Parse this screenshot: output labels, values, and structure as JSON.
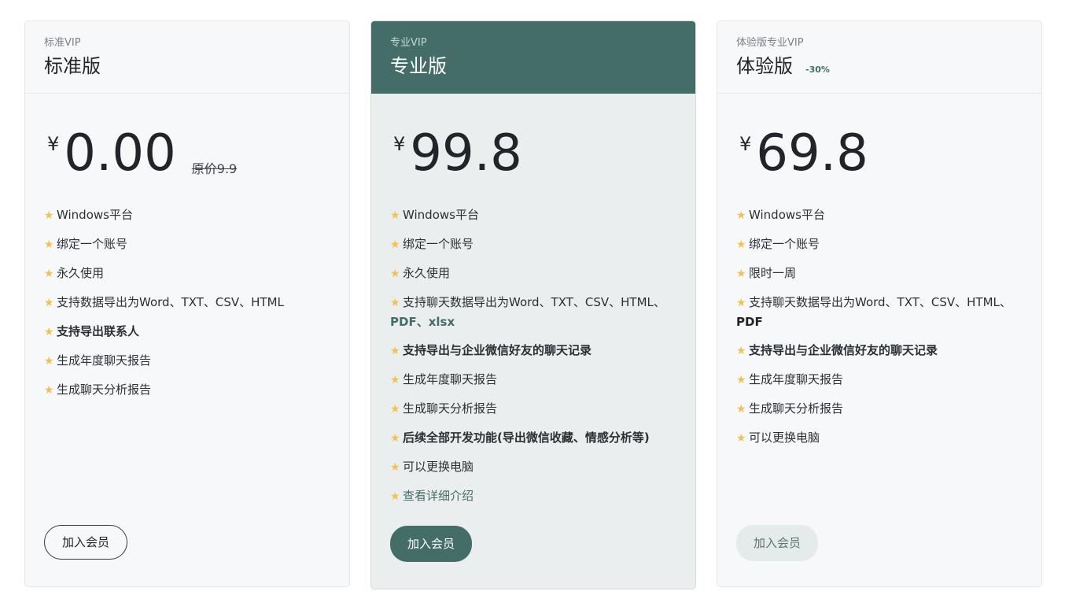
{
  "plans": [
    {
      "tier": "标准VIP",
      "title": "标准版",
      "discount": "",
      "currency": "¥",
      "price": "0.00",
      "original_price": "原价9.9",
      "features": {
        "f1": "Windows平台",
        "f2": "绑定一个账号",
        "f3": "永久使用",
        "f4": "支持数据导出为Word、TXT、CSV、HTML",
        "f5": "支持导出联系人",
        "f6": "生成年度聊天报告",
        "f7": "生成聊天分析报告"
      },
      "button": "加入会员"
    },
    {
      "tier": "专业VIP",
      "title": "专业版",
      "discount": "",
      "currency": "¥",
      "price": "99.8",
      "original_price": "",
      "features": {
        "f1": "Windows平台",
        "f2": "绑定一个账号",
        "f3": "永久使用",
        "f4a": "支持聊天数据导出为Word、TXT、CSV、HTML、",
        "f4b": "PDF",
        "f4c": "、",
        "f4d": "xlsx",
        "f5": "支持导出与企业微信好友的聊天记录",
        "f6": "生成年度聊天报告",
        "f7": "生成聊天分析报告",
        "f8": "后续全部开发功能(导出微信收藏、情感分析等)",
        "f9": "可以更换电脑",
        "f10": "查看详细介绍"
      },
      "button": "加入会员"
    },
    {
      "tier": "体验版专业VIP",
      "title": "体验版",
      "discount": "-30%",
      "currency": "¥",
      "price": "69.8",
      "original_price": "",
      "features": {
        "f1": "Windows平台",
        "f2": "绑定一个账号",
        "f3": "限时一周",
        "f4a": "支持聊天数据导出为Word、TXT、CSV、HTML、",
        "f4b": "PDF",
        "f5": "支持导出与企业微信好友的聊天记录",
        "f6": "生成年度聊天报告",
        "f7": "生成聊天分析报告",
        "f8": "可以更换电脑"
      },
      "button": "加入会员"
    }
  ],
  "icons": {
    "bullet": "star-icon",
    "star_glyph": "★"
  },
  "colors": {
    "accent": "#446d67",
    "star": "#f2c14e"
  }
}
